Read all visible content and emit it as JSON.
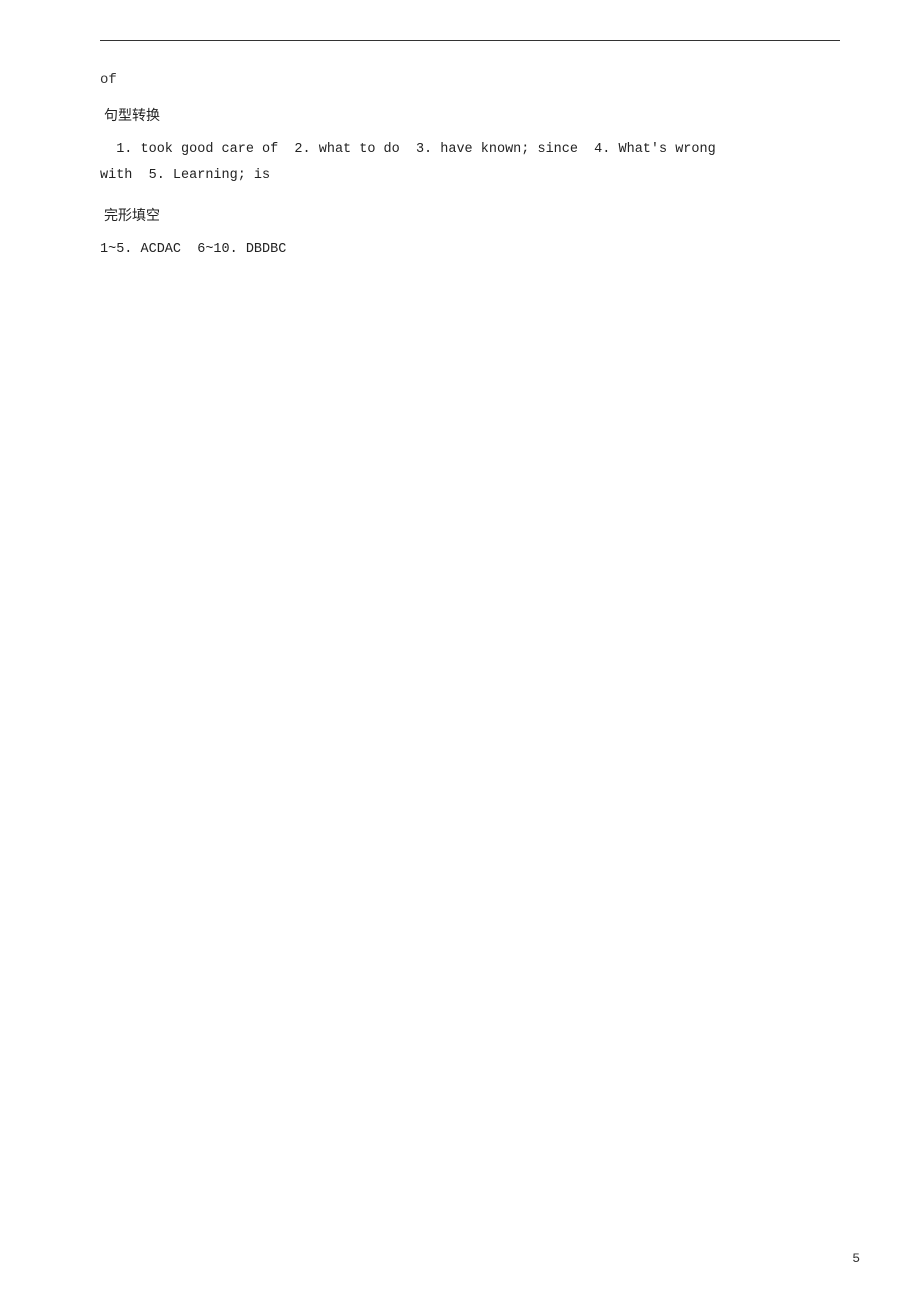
{
  "page": {
    "divider": true,
    "of_label": "of",
    "section1": {
      "heading": "句型转换",
      "line1": "  1. took good care of  2. what to do  3. have known; since  4. What's wrong",
      "line2": "with  5. Learning; is"
    },
    "section2": {
      "heading": "完形填空",
      "line1": "1~5. ACDAC  6~10. DBDBC"
    },
    "page_number": "5"
  }
}
